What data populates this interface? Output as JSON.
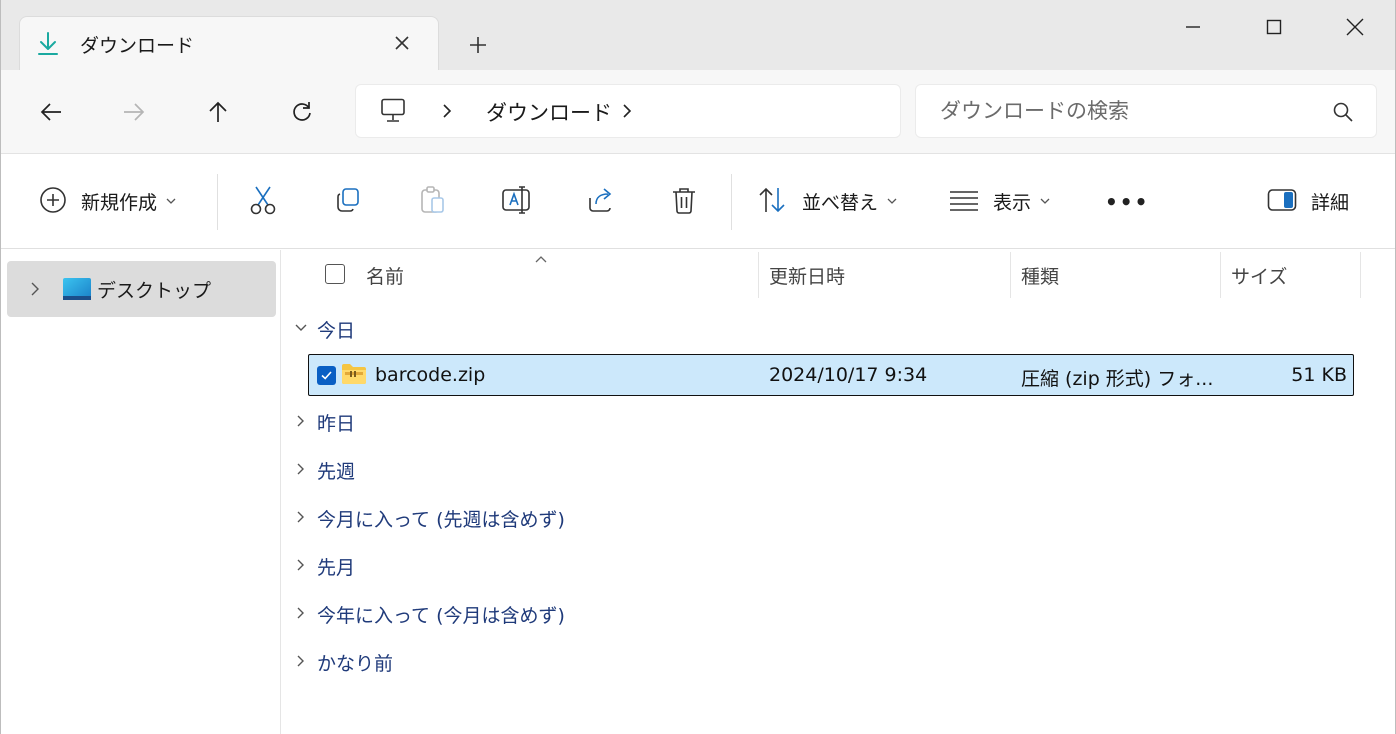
{
  "window": {
    "tab_title": "ダウンロード",
    "tab_icon": "download-icon",
    "controls": [
      "minimize-icon",
      "maximize-icon",
      "close-icon"
    ]
  },
  "navigation": {
    "buttons": [
      "back-icon",
      "forward-icon",
      "up-icon",
      "refresh-icon"
    ],
    "breadcrumb": {
      "root_icon": "pc-icon",
      "current": "ダウンロード"
    },
    "search_placeholder": "ダウンロードの検索"
  },
  "toolbar": {
    "new_label": "新規作成",
    "actions": [
      "cut-icon",
      "copy-icon",
      "paste-icon",
      "rename-icon",
      "share-icon",
      "delete-icon"
    ],
    "sort_label": "並べ替え",
    "view_label": "表示",
    "more_label": "•••",
    "details_label": "詳細"
  },
  "sidebar": {
    "items": [
      {
        "label": "デスクトップ",
        "icon": "desktop-folder-icon"
      }
    ]
  },
  "columns": {
    "name": "名前",
    "modified": "更新日時",
    "type": "種類",
    "size": "サイズ"
  },
  "groups": {
    "today": "今日",
    "yesterday": "昨日",
    "last_week": "先週",
    "this_month": "今月に入って (先週は含めず)",
    "last_month": "先月",
    "this_year": "今年に入って (今月は含めず)",
    "long_ago": "かなり前"
  },
  "files": [
    {
      "name": "barcode.zip",
      "modified": "2024/10/17 9:34",
      "type": "圧縮 (zip 形式) フォ...",
      "size": "51 KB",
      "selected": true,
      "icon": "zip-folder-icon"
    }
  ],
  "colors": {
    "selection_bg": "#cce8fb",
    "accent": "#0a5fc4",
    "group_text": "#1f3a7a"
  }
}
